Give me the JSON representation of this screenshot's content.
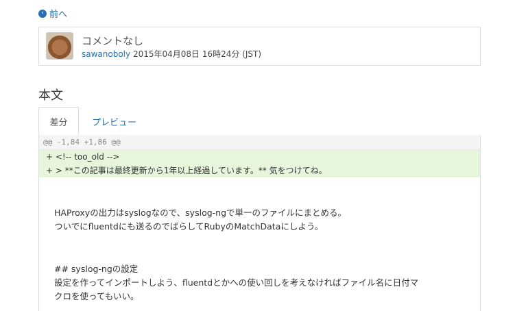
{
  "nav": {
    "back_label": "前へ"
  },
  "comment": {
    "text": "コメントなし",
    "author": "sawanoboly",
    "timestamp": "2015年04月08日 16時24分 (JST)"
  },
  "section": {
    "title": "本文"
  },
  "tabs": [
    {
      "label": "差分",
      "active": true
    },
    {
      "label": "プレビュー",
      "active": false
    }
  ],
  "diff": {
    "header": "@@ -1,84 +1,86 @@",
    "added": [
      "+ <!-- too_old -->",
      "+ > **この記事は最終更新から1年以上経過しています。** 気をつけてね。"
    ],
    "body": [
      "HAProxyの出力はsyslogなので、syslog-ngで単一のファイルにまとめる。",
      "ついでにfluentdにも送るのでばらしてRubyのMatchDataにしよう。",
      "## syslog-ngの設定",
      "設定を作ってインポートしよう、fluentdとかへの使い回しを考えなければファイル名に日付マ",
      "クロを使ってもいい。"
    ]
  },
  "colors": {
    "link": "#2a6fb0",
    "added_bg": "#e6f5dc",
    "border": "#dddddd"
  }
}
